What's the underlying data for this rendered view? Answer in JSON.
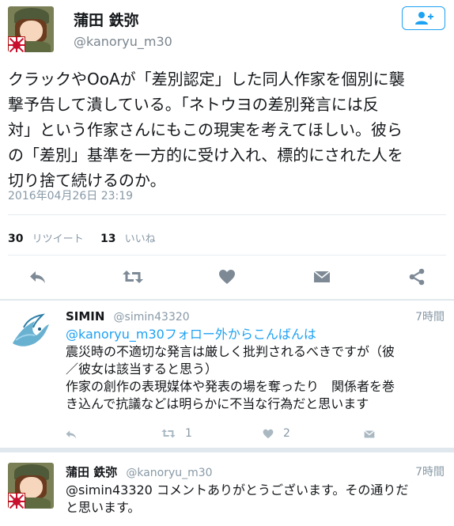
{
  "main_tweet": {
    "author_name": "蒲田 鉄弥",
    "author_handle": "@kanoryu_m30",
    "text_lines": [
      "クラックやOoAが「差別認定」した同人作家を個別に襲",
      "撃予告して潰している。「ネトウヨの差別発言には反",
      "対」という作家さんにもこの現実を考えてほしい。彼ら",
      "の「差別」基準を一方的に受け入れ、標的にされた人を",
      "切り捨て続けるのか。"
    ],
    "timestamp": "2016年04月26日 23:19",
    "retweets_count": "30",
    "retweets_label": "リツイート",
    "likes_count": "13",
    "likes_label": "いいね",
    "follow_icon": "add-user-icon"
  },
  "actions": {
    "reply_icon": "reply-icon",
    "retweet_icon": "retweet-icon",
    "like_icon": "heart-icon",
    "dm_icon": "envelope-icon",
    "share_icon": "share-icon"
  },
  "replies": [
    {
      "name": "SIMIN",
      "handle": "@simin43320",
      "time": "7時間",
      "lines": [
        "@kanoryu_m30フォロー外からこんばんは",
        "震災時の不適切な発言は厳しく批判されるべきですが（彼",
        "／彼女は該当すると思う）",
        "作家の創作の表現媒体や発表の場を奪ったり　関係者を巻",
        "き込んで抗議などは明らかに不当な行為だと思います"
      ],
      "retweet_count": "1",
      "like_count": "2"
    },
    {
      "name": "蒲田 鉄弥",
      "handle": "@kanoryu_m30",
      "time": "7時間",
      "lines": [
        "@simin43320 コメントありがとうございます。その通りだ",
        "と思います。"
      ]
    }
  ],
  "colors": {
    "accent": "#1da1f2",
    "muted": "#8899a6",
    "icon_gray": "#7d8a96"
  }
}
